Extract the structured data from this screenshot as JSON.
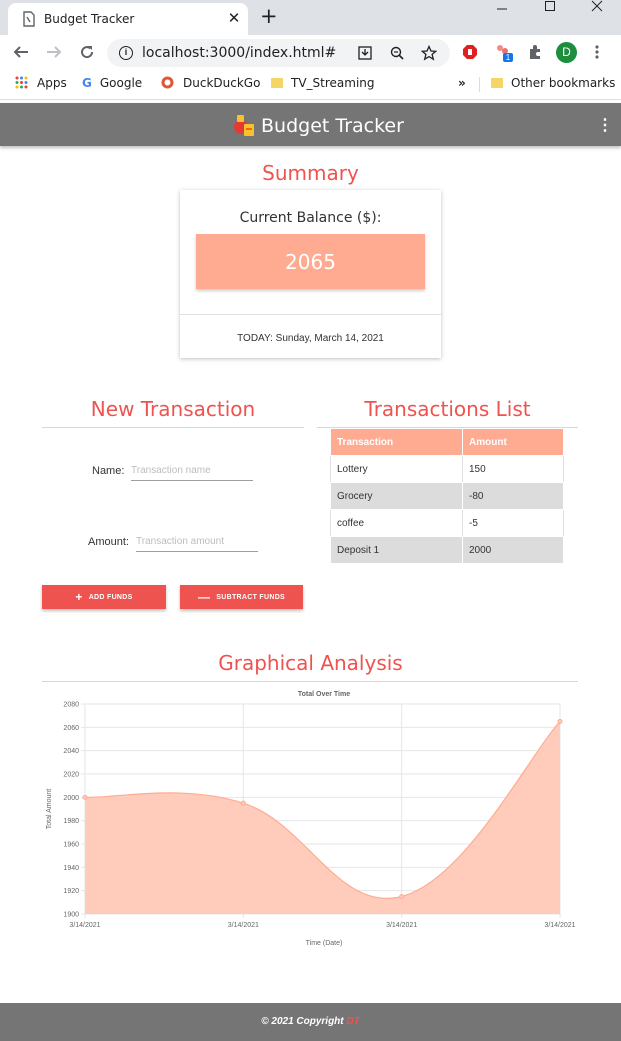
{
  "browser": {
    "tab_title": "Budget Tracker",
    "close_glyph": "✕",
    "new_tab_glyph": "+",
    "url": "localhost:3000/index.html#",
    "extension_badge": "1",
    "profile_initial": "D",
    "bookmarks": {
      "apps": "Apps",
      "google": "Google",
      "duckduckgo": "DuckDuckGo",
      "tv_streaming": "TV_Streaming",
      "overflow": "»",
      "other": "Other bookmarks"
    }
  },
  "app": {
    "title": "Budget Tracker",
    "menu_glyph": "⋮"
  },
  "summary": {
    "title": "Summary",
    "balance_label": "Current Balance ($):",
    "balance_value": "2065",
    "today": "TODAY: Sunday, March 14, 2021"
  },
  "new_transaction": {
    "title": "New Transaction",
    "name_label": "Name:",
    "name_placeholder": "Transaction name",
    "amount_label": "Amount:",
    "amount_placeholder": "Transaction amount",
    "add_symbol": "+",
    "add_label": "ADD FUNDS",
    "subtract_symbol": "—",
    "subtract_label": "SUBTRACT FUNDS"
  },
  "transactions": {
    "title": "Transactions List",
    "headers": [
      "Transaction",
      "Amount"
    ],
    "rows": [
      {
        "name": "Lottery",
        "amount": "150"
      },
      {
        "name": "Grocery",
        "amount": "-80"
      },
      {
        "name": "coffee",
        "amount": "-5"
      },
      {
        "name": "Deposit 1",
        "amount": "2000"
      }
    ]
  },
  "analysis": {
    "title": "Graphical Analysis"
  },
  "chart_data": {
    "type": "area",
    "title": "Total Over Time",
    "xlabel": "Time (Date)",
    "ylabel": "Total Amount",
    "categories": [
      "3/14/2021",
      "3/14/2021",
      "3/14/2021",
      "3/14/2021"
    ],
    "values": [
      2000,
      1995,
      1915,
      2065
    ],
    "ylim": [
      1900,
      2080
    ],
    "yticks": [
      1900,
      1920,
      1940,
      1960,
      1980,
      2000,
      2020,
      2040,
      2060,
      2080
    ],
    "fill_color": "#ffccbc",
    "line_color": "#ffab91",
    "grid": true
  },
  "footer": {
    "text": "© 2021 Copyright",
    "initials": "DT"
  },
  "colors": {
    "accent": "#ef5350",
    "salmon": "#ffab91",
    "header_gray": "#757575"
  }
}
